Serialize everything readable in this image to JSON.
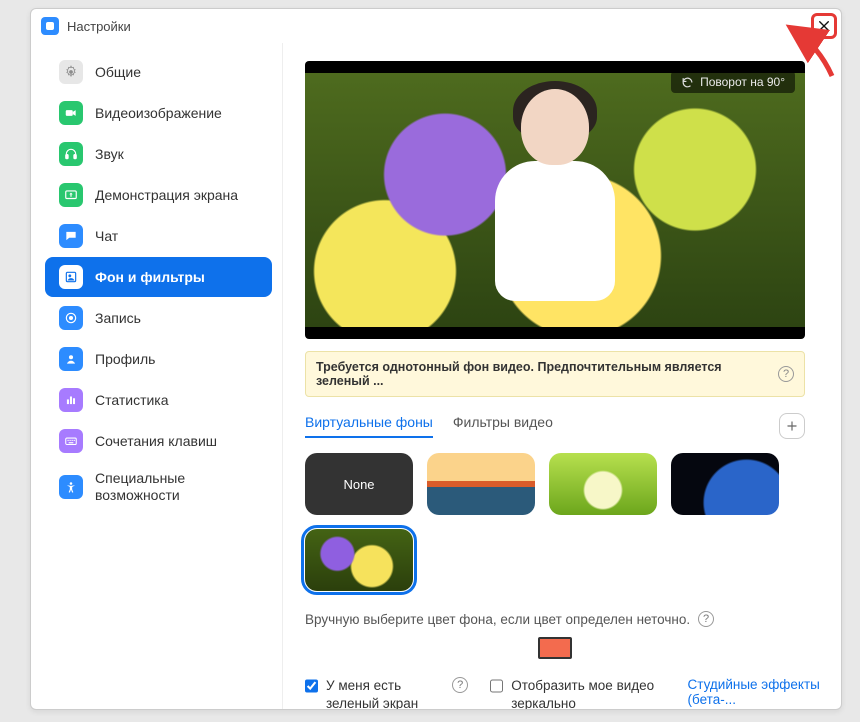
{
  "window": {
    "title": "Настройки"
  },
  "sidebar": {
    "items": [
      {
        "label": "Общие",
        "icon": "gear",
        "color": "#cfcfcf"
      },
      {
        "label": "Видеоизображение",
        "icon": "video",
        "color": "#29c76f"
      },
      {
        "label": "Звук",
        "icon": "audio",
        "color": "#29c76f"
      },
      {
        "label": "Демонстрация экрана",
        "icon": "share",
        "color": "#29c76f"
      },
      {
        "label": "Чат",
        "icon": "chat",
        "color": "#2D8CFF"
      },
      {
        "label": "Фон и фильтры",
        "icon": "bg",
        "color": "#2D8CFF",
        "active": true
      },
      {
        "label": "Запись",
        "icon": "record",
        "color": "#2D8CFF"
      },
      {
        "label": "Профиль",
        "icon": "profile",
        "color": "#2D8CFF"
      },
      {
        "label": "Статистика",
        "icon": "stats",
        "color": "#a77bff"
      },
      {
        "label": "Сочетания клавиш",
        "icon": "keyboard",
        "color": "#a77bff"
      },
      {
        "label": "Специальные возможности",
        "icon": "access",
        "color": "#2D8CFF"
      }
    ]
  },
  "preview": {
    "rotate_label": "Поворот на 90°"
  },
  "banner": {
    "text": "Требуется однотонный фон видео. Предпочтительным является зеленый ..."
  },
  "tabs": {
    "virtual": "Виртуальные фоны",
    "filters": "Фильтры видео"
  },
  "thumbs": {
    "none_label": "None"
  },
  "manual": {
    "text": "Вручную выберите цвет фона, если цвет определен неточно."
  },
  "swatch": {
    "color": "#f36b4e"
  },
  "checks": {
    "green": "У меня есть зеленый экран",
    "mirror": "Отобразить мое видео зеркально"
  },
  "studio_link": "Студийные эффекты (бета-..."
}
